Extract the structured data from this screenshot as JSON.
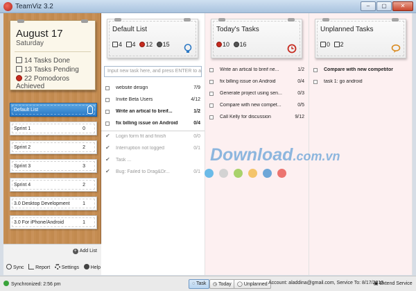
{
  "window": {
    "title": "TeamViz 3.2",
    "min": "–",
    "max": "▢",
    "close": "✕"
  },
  "sidebar": {
    "date": "August 17",
    "day": "Saturday",
    "stats": [
      {
        "text": "14 Tasks Done",
        "icon": "checked-box-icon"
      },
      {
        "text": "13 Tasks Pending",
        "icon": "empty-box-icon"
      },
      {
        "text": "22 Pomodoros Achieved",
        "icon": "tomato-icon"
      }
    ],
    "lists": [
      {
        "name": "Default List",
        "count": ""
      },
      {
        "name": "Sprint 1",
        "count": "0"
      },
      {
        "name": "Sprint 2",
        "count": "2"
      },
      {
        "name": "Sprint 3",
        "count": "3"
      },
      {
        "name": "Sprint 4",
        "count": "2"
      },
      {
        "name": "3.0 Desktop Development",
        "count": "1"
      },
      {
        "name": "3.0 For iPhone/Android",
        "count": "1"
      }
    ],
    "add_list": "Add List",
    "tools": [
      "Sync",
      "Report",
      "Settings",
      "Help"
    ]
  },
  "default_list": {
    "title": "Default List",
    "stats": [
      "4",
      "4",
      "12",
      "15"
    ],
    "new_task_placeholder": "Input new task here, and press ENTER to a",
    "tasks": [
      {
        "title": "website design",
        "count": "7/9",
        "style": "normal"
      },
      {
        "title": "Invite Beta Users",
        "count": "4/12",
        "style": "normal"
      },
      {
        "title": "Write an artical to breif...",
        "count": "1/2",
        "style": "bold"
      },
      {
        "title": "fix billing issue on Android",
        "count": "0/4",
        "style": "bold"
      },
      {
        "title": "Login form fit and finish",
        "count": "0/0",
        "style": "done"
      },
      {
        "title": "Interruption not logged",
        "count": "0/1",
        "style": "done"
      },
      {
        "title": "Task ...",
        "count": "",
        "style": "done"
      },
      {
        "title": "Bug: Failed to Drag&Dr...",
        "count": "0/1",
        "style": "done"
      }
    ]
  },
  "todays_tasks": {
    "title": "Today's Tasks",
    "stats": [
      "10",
      "16"
    ],
    "tasks": [
      {
        "title": "Write an artical to breif ne...",
        "count": "1/2"
      },
      {
        "title": "fix billing issue on Android",
        "count": "0/4"
      },
      {
        "title": "Generate project using sen...",
        "count": "0/3"
      },
      {
        "title": "Compare with new compet...",
        "count": "0/5"
      },
      {
        "title": "Call Kelly for discussion",
        "count": "9/12"
      }
    ]
  },
  "unplanned_tasks": {
    "title": "Unplanned Tasks",
    "stats": [
      "0",
      "2"
    ],
    "tasks": [
      {
        "title": "Compare with new competitor",
        "count": "",
        "style": "bold"
      },
      {
        "title": "task 1: go android",
        "count": "",
        "style": "normal"
      }
    ]
  },
  "color_dots": [
    "#6bbbe8",
    "#d3d3d3",
    "#a9d26b",
    "#f4c46a",
    "#6ea7d8",
    "#ec7470"
  ],
  "watermark": {
    "main": "Download",
    "suffix": ".com.vn"
  },
  "statusbar": {
    "synced": "Synchronized: 2:56 pm",
    "buttons": [
      "Task",
      "Today",
      "Unplanned"
    ],
    "account": "Account: aladdina@gmail.com, Service To: 8/17/2013",
    "extend": "Extend Service"
  }
}
